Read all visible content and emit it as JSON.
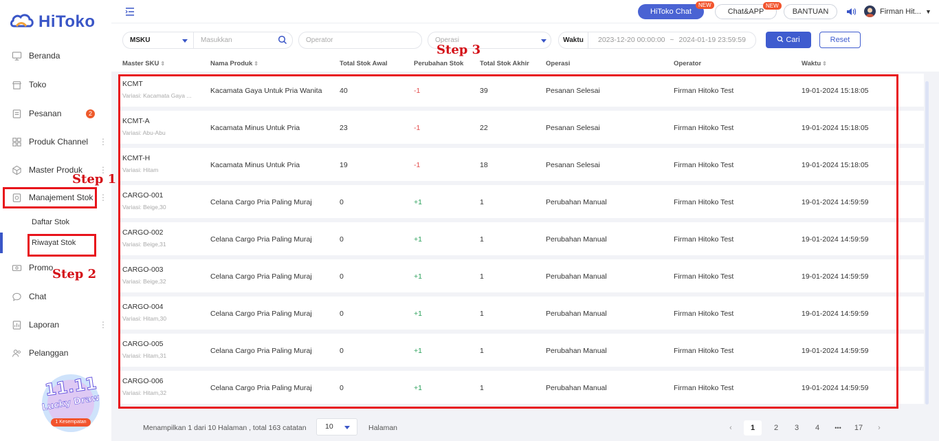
{
  "app": {
    "brand": "HiToko"
  },
  "sidebar": {
    "items": [
      {
        "label": "Beranda",
        "icon": "monitor-icon"
      },
      {
        "label": "Toko",
        "icon": "store-icon"
      },
      {
        "label": "Pesanan",
        "icon": "order-icon",
        "badge": "2"
      },
      {
        "label": "Produk Channel",
        "icon": "grid-icon"
      },
      {
        "label": "Master Produk",
        "icon": "cube-icon"
      },
      {
        "label": "Manajement Stok",
        "icon": "stock-icon"
      },
      {
        "label": "Promo",
        "icon": "promo-icon"
      },
      {
        "label": "Chat",
        "icon": "chat-icon"
      },
      {
        "label": "Laporan",
        "icon": "report-icon"
      },
      {
        "label": "Pelanggan",
        "icon": "customer-icon"
      }
    ],
    "sub_items": [
      "Daftar Stok",
      "Riwayat Stok"
    ],
    "promo": {
      "line1": "11.11",
      "line2": "Lucky Draw",
      "line3": "1 Kesempatan"
    }
  },
  "header": {
    "hitoko_chat": "HiToko Chat",
    "chat_app": "Chat&APP",
    "new_tag": "NEW",
    "bantuan": "BANTUAN",
    "user_name": "Firman Hit..."
  },
  "filters": {
    "sku_select": "MSKU",
    "keyword_placeholder": "Masukkan",
    "operator_placeholder": "Operator",
    "operasi_placeholder": "Operasi",
    "waktu_label": "Waktu",
    "date_start": "2023-12-20 00:00:00",
    "date_sep": "~",
    "date_end": "2024-01-19 23:59:59",
    "cari": "Cari",
    "reset": "Reset"
  },
  "table": {
    "columns": [
      "Master SKU",
      "Nama Produk",
      "Total Stok Awal",
      "Perubahan Stok",
      "Total Stok Akhir",
      "Operasi",
      "Operator",
      "Waktu"
    ],
    "rows": [
      {
        "sku": "KCMT",
        "variasi": "Variasi: Kacamata Gaya ...",
        "produk": "Kacamata Gaya Untuk Pria Wanita",
        "awal": "40",
        "perubahan": "-1",
        "akhir": "39",
        "operasi": "Pesanan Selesai",
        "operator": "Firman Hitoko Test",
        "waktu": "19-01-2024 15:18:05"
      },
      {
        "sku": "KCMT-A",
        "variasi": "Variasi: Abu-Abu",
        "produk": "Kacamata Minus Untuk Pria",
        "awal": "23",
        "perubahan": "-1",
        "akhir": "22",
        "operasi": "Pesanan Selesai",
        "operator": "Firman Hitoko Test",
        "waktu": "19-01-2024 15:18:05"
      },
      {
        "sku": "KCMT-H",
        "variasi": "Variasi: Hitam",
        "produk": "Kacamata Minus Untuk Pria",
        "awal": "19",
        "perubahan": "-1",
        "akhir": "18",
        "operasi": "Pesanan Selesai",
        "operator": "Firman Hitoko Test",
        "waktu": "19-01-2024 15:18:05"
      },
      {
        "sku": "CARGO-001",
        "variasi": "Variasi: Beige,30",
        "produk": "Celana Cargo Pria Paling Muraj",
        "awal": "0",
        "perubahan": "+1",
        "akhir": "1",
        "operasi": "Perubahan Manual",
        "operator": "Firman Hitoko Test",
        "waktu": "19-01-2024 14:59:59"
      },
      {
        "sku": "CARGO-002",
        "variasi": "Variasi: Beige,31",
        "produk": "Celana Cargo Pria Paling Muraj",
        "awal": "0",
        "perubahan": "+1",
        "akhir": "1",
        "operasi": "Perubahan Manual",
        "operator": "Firman Hitoko Test",
        "waktu": "19-01-2024 14:59:59"
      },
      {
        "sku": "CARGO-003",
        "variasi": "Variasi: Beige,32",
        "produk": "Celana Cargo Pria Paling Muraj",
        "awal": "0",
        "perubahan": "+1",
        "akhir": "1",
        "operasi": "Perubahan Manual",
        "operator": "Firman Hitoko Test",
        "waktu": "19-01-2024 14:59:59"
      },
      {
        "sku": "CARGO-004",
        "variasi": "Variasi: Hitam,30",
        "produk": "Celana Cargo Pria Paling Muraj",
        "awal": "0",
        "perubahan": "+1",
        "akhir": "1",
        "operasi": "Perubahan Manual",
        "operator": "Firman Hitoko Test",
        "waktu": "19-01-2024 14:59:59"
      },
      {
        "sku": "CARGO-005",
        "variasi": "Variasi: Hitam,31",
        "produk": "Celana Cargo Pria Paling Muraj",
        "awal": "0",
        "perubahan": "+1",
        "akhir": "1",
        "operasi": "Perubahan Manual",
        "operator": "Firman Hitoko Test",
        "waktu": "19-01-2024 14:59:59"
      },
      {
        "sku": "CARGO-006",
        "variasi": "Variasi: Hitam,32",
        "produk": "Celana Cargo Pria Paling Muraj",
        "awal": "0",
        "perubahan": "+1",
        "akhir": "1",
        "operasi": "Perubahan Manual",
        "operator": "Firman Hitoko Test",
        "waktu": "19-01-2024 14:59:59"
      }
    ]
  },
  "pagination": {
    "summary": "Menampilkan 1 dari 10 Halaman , total 163 catatan",
    "page_size": "10",
    "halaman": "Halaman",
    "pages": [
      "1",
      "2",
      "3",
      "4",
      "•••",
      "17"
    ],
    "prev": "‹",
    "next": "›"
  },
  "annotations": {
    "step1": "Step 1",
    "step2": "Step 2",
    "step3": "Step 3"
  },
  "colors": {
    "accent": "#3f5ccf",
    "negative": "#e34d4d",
    "positive": "#2aa05a",
    "annotation": "#e8131b"
  }
}
